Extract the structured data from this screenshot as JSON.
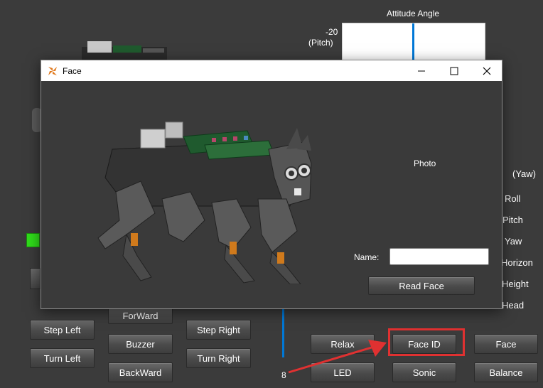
{
  "main": {
    "attitude_title": "Attitude Angle",
    "pitch_value": "-20",
    "pitch_label": "(Pitch)",
    "yaw_label": "(Yaw)",
    "slider_min": "8",
    "sliders": [
      "Roll",
      "Pitch",
      "Yaw",
      "Horizon",
      "Height",
      "Head"
    ],
    "buttons": {
      "forward": "ForWard",
      "step_left": "Step Left",
      "buzzer": "Buzzer",
      "step_right": "Step Right",
      "turn_left": "Turn Left",
      "turn_right": "Turn Right",
      "backward": "BackWard",
      "relax": "Relax",
      "face_id": "Face ID",
      "face": "Face",
      "led": "LED",
      "sonic": "Sonic",
      "balance": "Balance"
    },
    "status_color": "#2fdc1a",
    "accent_color": "#0078d7",
    "highlight_color": "#e03131"
  },
  "face_window": {
    "title": "Face",
    "app_icon": "pinwheel-icon",
    "minimize": "minimize-icon",
    "maximize": "maximize-icon",
    "close": "close-icon",
    "photo_label": "Photo",
    "name_label": "Name:",
    "name_value": "",
    "read_face": "Read Face"
  }
}
